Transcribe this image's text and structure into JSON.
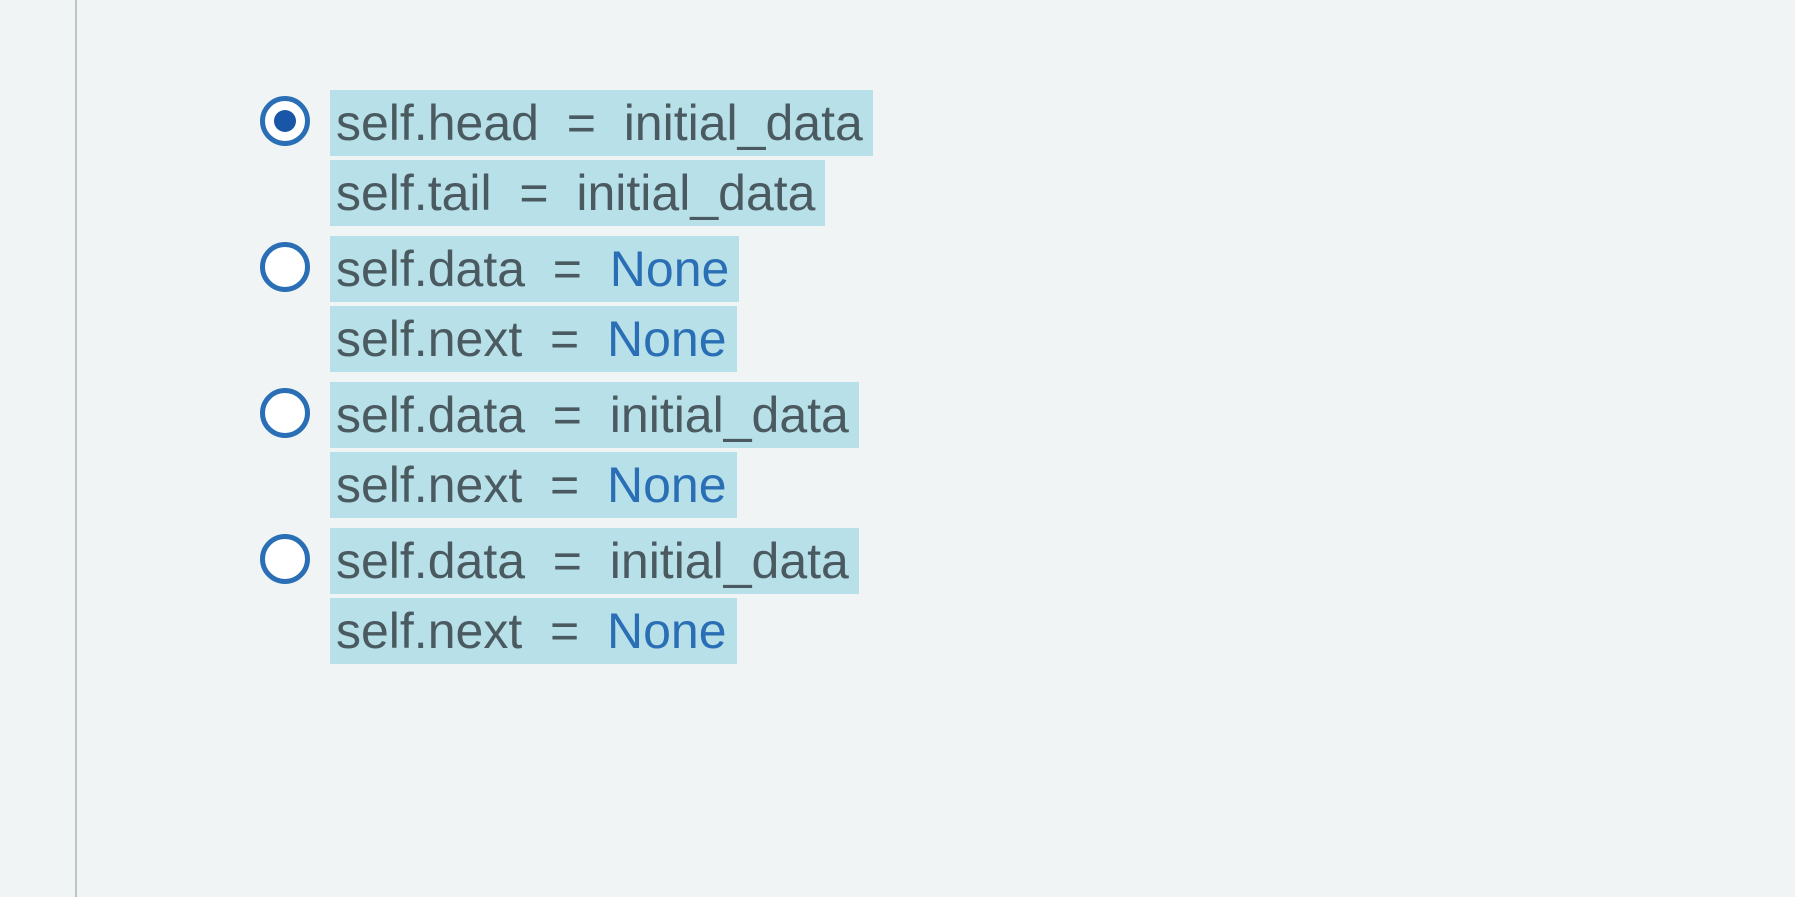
{
  "options": [
    {
      "selected": true,
      "lines": [
        {
          "pre": "self.head  =  ",
          "val": "initial_data",
          "valBlue": false
        },
        {
          "pre": "self.tail  =  ",
          "val": "initial_data",
          "valBlue": false
        }
      ]
    },
    {
      "selected": false,
      "lines": [
        {
          "pre": "self.data  =  ",
          "val": "None",
          "valBlue": true
        },
        {
          "pre": "self.next  =  ",
          "val": "None",
          "valBlue": true
        }
      ]
    },
    {
      "selected": false,
      "lines": [
        {
          "pre": "self.data  =  ",
          "val": "initial_data",
          "valBlue": false
        },
        {
          "pre": "self.next  =  ",
          "val": "None",
          "valBlue": true
        }
      ]
    },
    {
      "selected": false,
      "lines": [
        {
          "pre": "self.data  =  ",
          "val": "initial_data",
          "valBlue": false
        },
        {
          "pre": "self.next  =  ",
          "val": "None",
          "valBlue": true
        }
      ]
    }
  ]
}
